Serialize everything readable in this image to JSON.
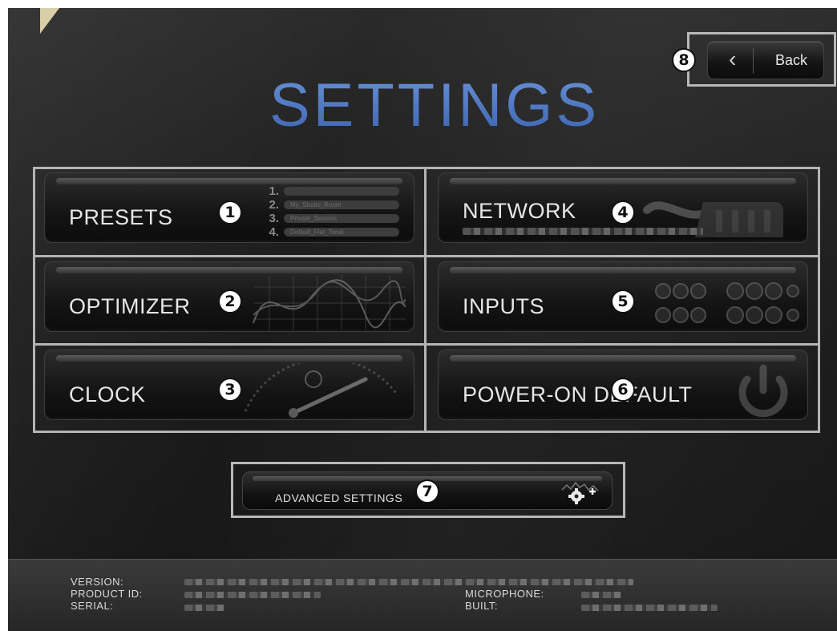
{
  "title": "SETTINGS",
  "back": {
    "label": "Back",
    "callout": "8"
  },
  "tiles": [
    {
      "label": "PRESETS",
      "callout": "1"
    },
    {
      "label": "NETWORK",
      "callout": "4"
    },
    {
      "label": "OPTIMIZER",
      "callout": "2"
    },
    {
      "label": "INPUTS",
      "callout": "5"
    },
    {
      "label": "CLOCK",
      "callout": "3"
    },
    {
      "label": "POWER-ON DEFAULT",
      "callout": "6"
    }
  ],
  "presets_preview": {
    "numbers": [
      "1.",
      "2.",
      "3.",
      "4."
    ],
    "names": [
      "",
      "My_Studio_Room",
      "Private_Session",
      "Default_Flat_Tonal"
    ]
  },
  "advanced": {
    "label": "ADVANCED SETTINGS",
    "callout": "7"
  },
  "footer": {
    "version_label": "VERSION:",
    "product_id_label": "PRODUCT ID:",
    "serial_label": "SERIAL:",
    "microphone_label": "MICROPHONE:",
    "built_label": "BUILT:"
  },
  "colors": {
    "title_blue": "#4d78c4",
    "frame_gray": "#b4b4b4",
    "tile_text": "#e6e6e6"
  }
}
